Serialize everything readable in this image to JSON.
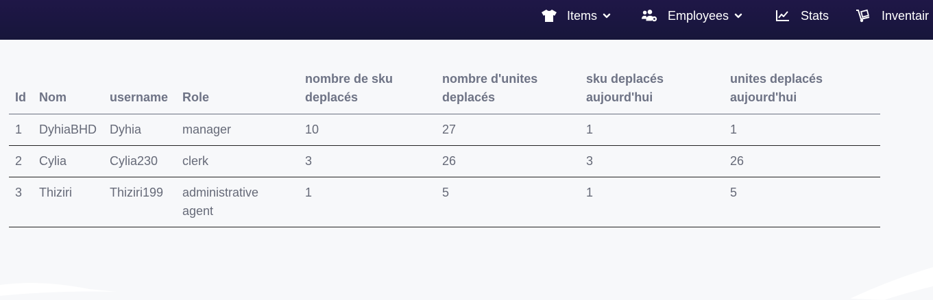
{
  "nav": {
    "items": [
      {
        "label": "Items",
        "icon": "tshirt-icon",
        "has_dropdown": true
      },
      {
        "label": "Employees",
        "icon": "users-cog-icon",
        "has_dropdown": true
      },
      {
        "label": "Stats",
        "icon": "chart-line-icon",
        "has_dropdown": false
      },
      {
        "label": "Inventair",
        "icon": "dolly-icon",
        "has_dropdown": false
      }
    ]
  },
  "colors": {
    "topbar": "#1c1743",
    "background": "#f7f8fa",
    "text": "#666a78"
  },
  "table": {
    "headers": [
      "Id",
      "Nom",
      "username",
      "Role",
      "nombre de sku deplacés",
      "nombre d'unites deplacés",
      "sku deplacés aujourd'hui",
      "unites deplacés aujourd'hui"
    ],
    "rows": [
      [
        "1",
        "DyhiaBHD",
        "Dyhia",
        "manager",
        "10",
        "27",
        "1",
        "1"
      ],
      [
        "2",
        "Cylia",
        "Cylia230",
        "clerk",
        "3",
        "26",
        "3",
        "26"
      ],
      [
        "3",
        "Thiziri",
        "Thiziri199",
        "administrative agent",
        "1",
        "5",
        "1",
        "5"
      ]
    ]
  }
}
